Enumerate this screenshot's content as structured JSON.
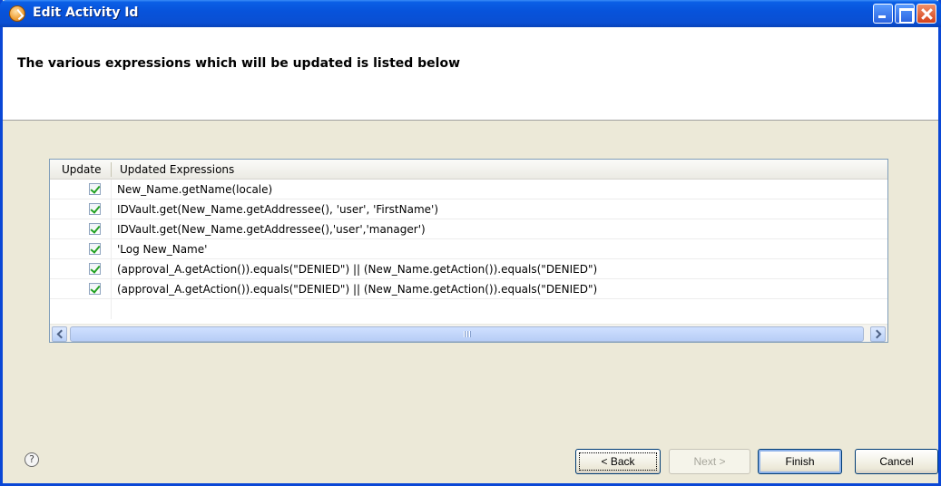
{
  "window": {
    "title": "Edit Activity Id"
  },
  "header": {
    "description": "The various expressions which will be updated is listed below"
  },
  "table": {
    "columns": [
      "Update",
      "Updated Expressions"
    ],
    "rows": [
      {
        "checked": true,
        "expression": "New_Name.getName(locale)"
      },
      {
        "checked": true,
        "expression": "IDVault.get(New_Name.getAddressee(), 'user', 'FirstName')"
      },
      {
        "checked": true,
        "expression": "IDVault.get(New_Name.getAddressee(),'user','manager')"
      },
      {
        "checked": true,
        "expression": "'Log New_Name'"
      },
      {
        "checked": true,
        "expression": "(approval_A.getAction()).equals(\"DENIED\") || (New_Name.getAction()).equals(\"DENIED\")"
      },
      {
        "checked": true,
        "expression": "(approval_A.getAction()).equals(\"DENIED\") || (New_Name.getAction()).equals(\"DENIED\")"
      }
    ]
  },
  "help": {
    "icon": "help-icon",
    "glyph": "?"
  },
  "buttons": {
    "back": "< Back",
    "next": "Next >",
    "finish": "Finish",
    "cancel": "Cancel"
  },
  "colors": {
    "titlebar": "#0753db",
    "dialog_bg": "#ece9d8",
    "check": "#21a121"
  }
}
